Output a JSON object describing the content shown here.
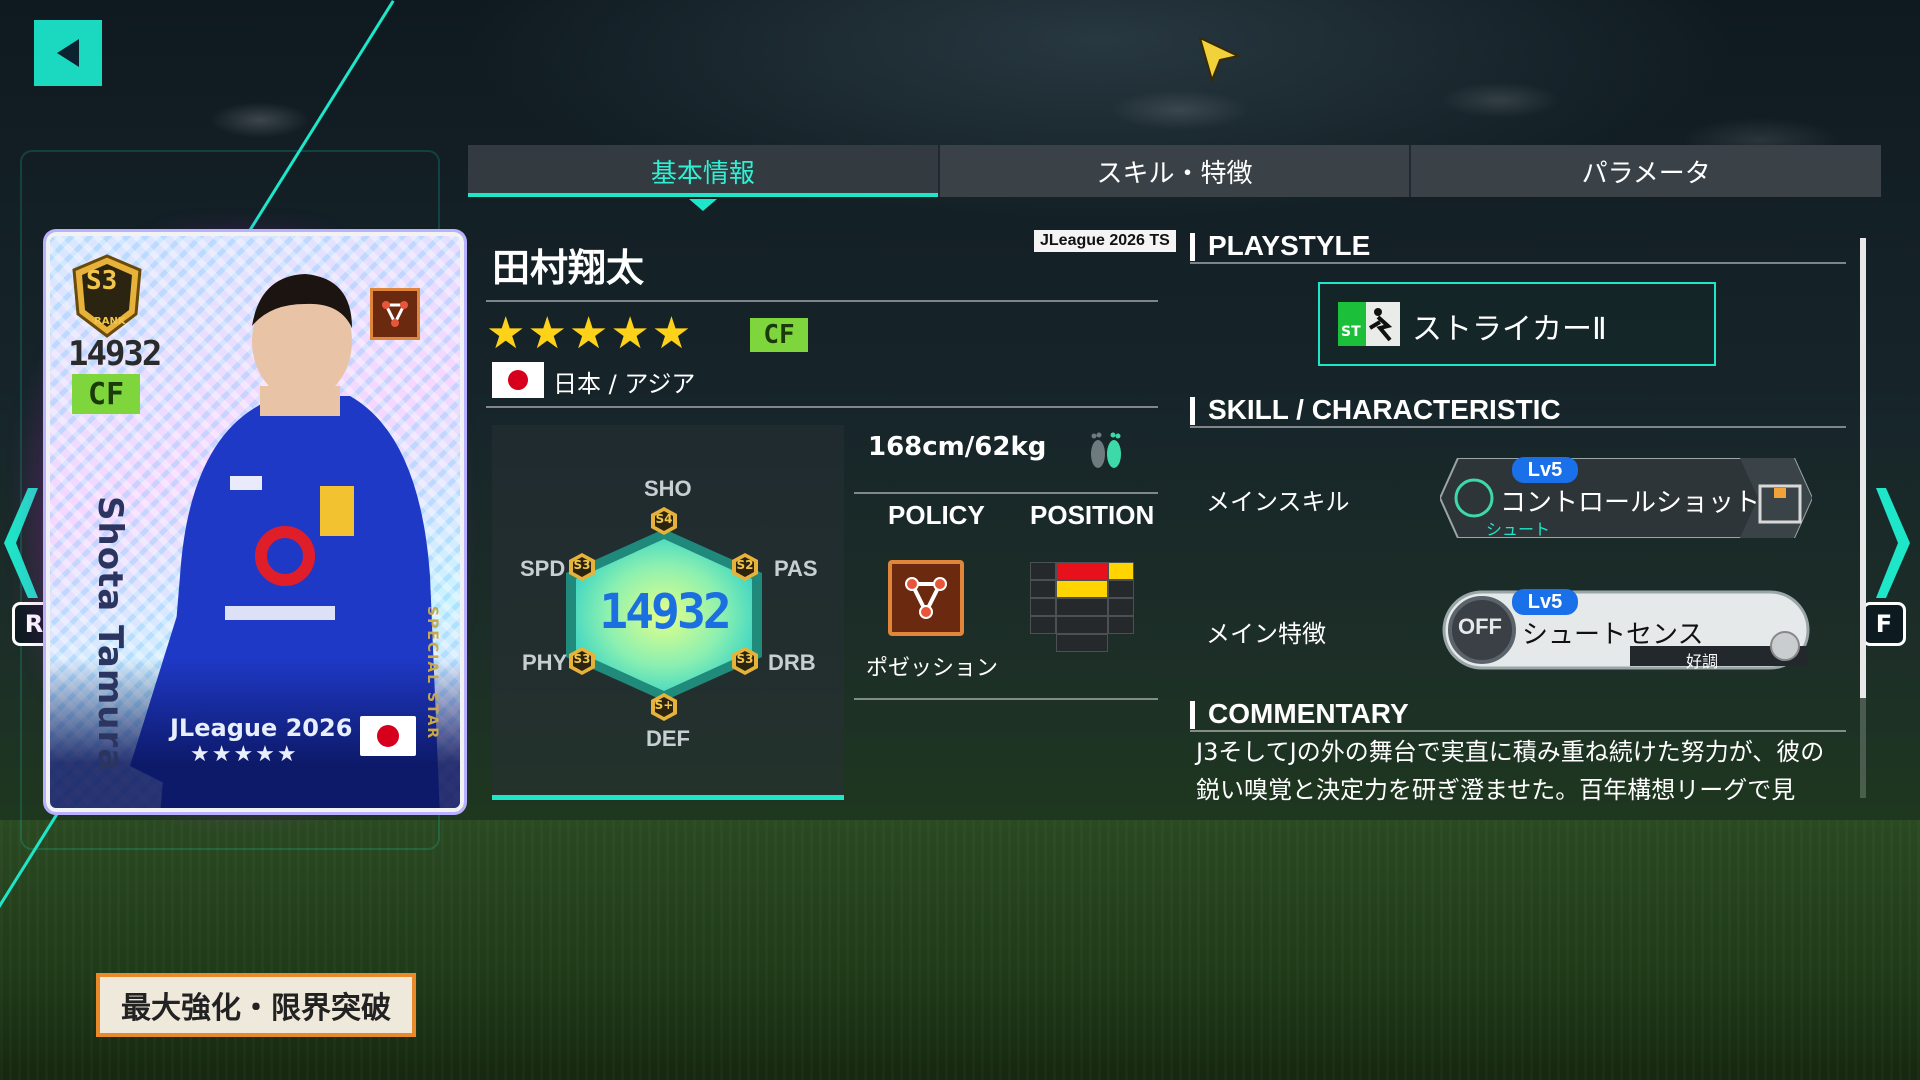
{
  "tabs": [
    {
      "label": "基本情報",
      "active": true
    },
    {
      "label": "スキル・特徴",
      "active": false
    },
    {
      "label": "パラメータ",
      "active": false
    }
  ],
  "card": {
    "rank": "S3",
    "rank_sub": "RANK",
    "overall": "14932",
    "position": "CF",
    "name": "Shota Tamura",
    "special_label": "SPECIAL STAR",
    "edition": "JLeague 2026 TS",
    "stars": "★★★★★",
    "playstyle_icon": "striker-node-icon"
  },
  "player": {
    "edition_tag": "JLeague 2026 TS",
    "name": "田村翔太",
    "stars": "★★★★★",
    "rarity": 5,
    "position": "CF",
    "nationality": "日本 / アジア",
    "height_weight": "168cm/62kg",
    "preferred_foot_icon": "feet-icon"
  },
  "stats": {
    "total": "14932",
    "labels": {
      "sho": "SHO",
      "pas": "PAS",
      "drb": "DRB",
      "def": "DEF",
      "phy": "PHY",
      "spd": "SPD"
    },
    "grades": {
      "sho": "S4",
      "pas": "S2",
      "drb": "S3",
      "def": "S+",
      "phy": "S3",
      "spd": "S3"
    }
  },
  "policy": {
    "heading": "POLICY",
    "label": "ポゼッション",
    "icon": "possession-icon"
  },
  "position_map": {
    "heading": "POSITION",
    "primary_color": "#e8101a",
    "secondary_color": "#ffd400"
  },
  "right": {
    "playstyle_heading": "PLAYSTYLE",
    "playstyle_code": "ST",
    "playstyle_name": "ストライカーⅡ",
    "skill_heading": "SKILL / CHARACTERISTIC",
    "main_skill_label": "メインスキル",
    "main_skill": {
      "level": "Lv5",
      "name": "コントロールショット",
      "category": "シュート"
    },
    "main_trait_label": "メイン特徴",
    "main_trait": {
      "level": "Lv5",
      "name": "シュートセンス",
      "state": "OFF",
      "condition": "好調"
    },
    "commentary_heading": "COMMENTARY",
    "commentary": "J3そしてJの外の舞台で実直に積み重ね続けた努力が、彼の鋭い嗅覚と決定力を研ぎ澄ませた。百年構想リーグで見"
  },
  "controls": {
    "left_key": "R",
    "right_key": "F",
    "upgrade_button": "最大強化・限界突破"
  },
  "colors": {
    "accent": "#1ee6c8",
    "star": "#ffd21a",
    "position_green": "#7fd63c",
    "upgrade_border": "#e88a2c"
  }
}
